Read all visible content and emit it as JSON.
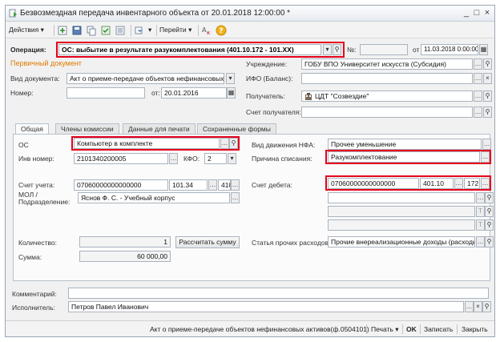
{
  "window": {
    "title": "Безвозмездная передача инвентарного объекта  от 20.01.2018 12:00:00 *",
    "minimize": "_",
    "maximize": "□",
    "close": "×"
  },
  "toolbar": {
    "actions_label": "Действия",
    "goto_label": "Перейти",
    "dropdown_arrow": "▾"
  },
  "operation": {
    "label": "Операция:",
    "value": "ОС: выбытие в результате разукомплектования (401.10.172 - 101.XX)",
    "number_label": "№:",
    "number_value": "",
    "date_label": "от",
    "date_value": "11.03.2018  0:00:00"
  },
  "primary_doc": {
    "header": "Первичный документ",
    "doc_type_label": "Вид документа:",
    "doc_type_value": "Акт о приеме-передаче объектов нефинансовых а",
    "number_label": "Номер:",
    "number_value": "",
    "date_label": "от:",
    "date_value": "20.01.2016"
  },
  "institution": {
    "label": "Учреждение:",
    "value": "ГОБУ ВПО Университет искусств (Субсидия)",
    "ifo_label": "ИФО (Баланс):",
    "ifo_value": "",
    "recipient_label": "Получатель:",
    "recipient_value": "ЦДТ \"Созвездие\"",
    "recipient_account_label": "Счет получателя:",
    "recipient_account_value": ""
  },
  "tabs": [
    {
      "label": "Общая"
    },
    {
      "label": "Члены комиссии"
    },
    {
      "label": "Данные для печати"
    },
    {
      "label": "Сохраненные формы"
    }
  ],
  "general": {
    "os_label": "ОС",
    "os_value": "Компьютер в комплекте",
    "inv_label": "Инв номер:",
    "inv_value": "2101340200005",
    "kfo_label": "КФО:",
    "kfo_value": "2",
    "account_label": "Счет учета:",
    "account_value": "07060000000000000",
    "account_kosgu": "101.34",
    "account_code": "410",
    "mol_label": "МОЛ /",
    "subdivision_label": "Подразделение:",
    "mol_value": "Яснов Ф. С. - Учебный корпус",
    "quantity_label": "Количество:",
    "quantity_value": "1",
    "recalc_label": "Рассчитать сумму",
    "sum_label": "Сумма:",
    "sum_value": "60 000,00",
    "movement_label": "Вид движения НФА:",
    "movement_value": "Прочее уменьшение",
    "reason_label": "Причина списания:",
    "reason_value": "Разукомплектование",
    "debit_label": "Счет дебета:",
    "debit_value": "07060000000000000",
    "debit_kosgu": "401.10",
    "debit_code": "172",
    "other_exp_label": "Статья прочих расходов:",
    "other_exp_value": "Прочие внереализационные доходы (расходы"
  },
  "footer": {
    "comment_label": "Комментарий:",
    "comment_value": "",
    "executor_label": "Исполнитель:",
    "executor_value": "Петров Павел Иванович"
  },
  "statusbar": {
    "print_form": "Акт о приеме-передаче объектов нефинансовых активов(ф.0504101)",
    "print_label": "Печать",
    "ok_label": "OK",
    "save_label": "Записать",
    "close_label": "Закрыть"
  },
  "colors": {
    "highlight": "#e5001b",
    "section_header": "#e07a00"
  }
}
